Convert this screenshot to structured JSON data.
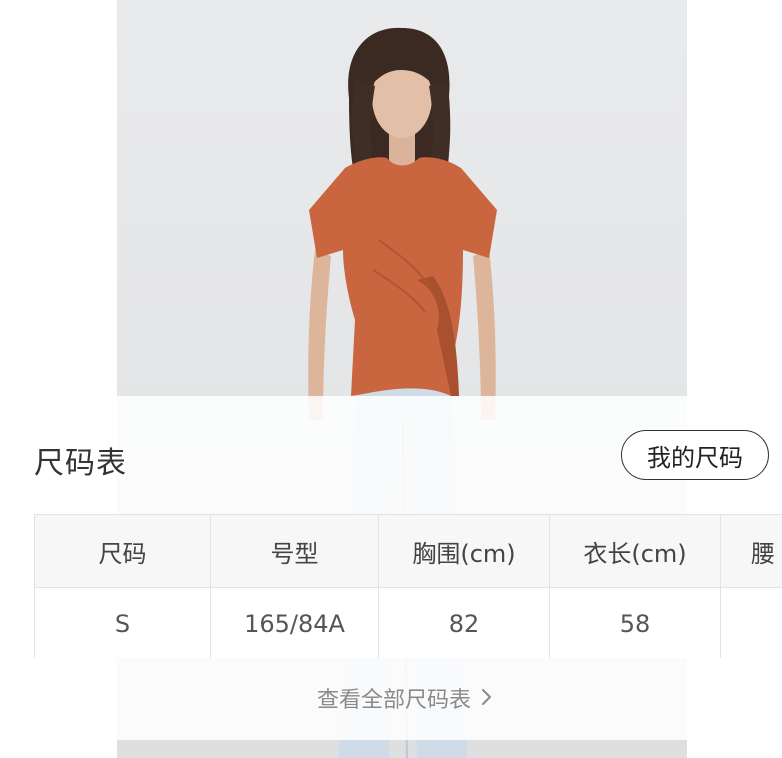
{
  "size_chart": {
    "title": "尺码表",
    "my_size_label": "我的尺码",
    "headers": [
      "尺码",
      "号型",
      "胸围(cm)",
      "衣长(cm)",
      "腰"
    ],
    "rows": [
      [
        "S",
        "165/84A",
        "82",
        "58",
        ""
      ]
    ],
    "view_all_label": "查看全部尺码表",
    "chevron_icon": "chevron-right-icon"
  },
  "colors": {
    "shirt": "#c9663f",
    "jeans": "#cfdbe6",
    "background": "#e6e7e9"
  }
}
